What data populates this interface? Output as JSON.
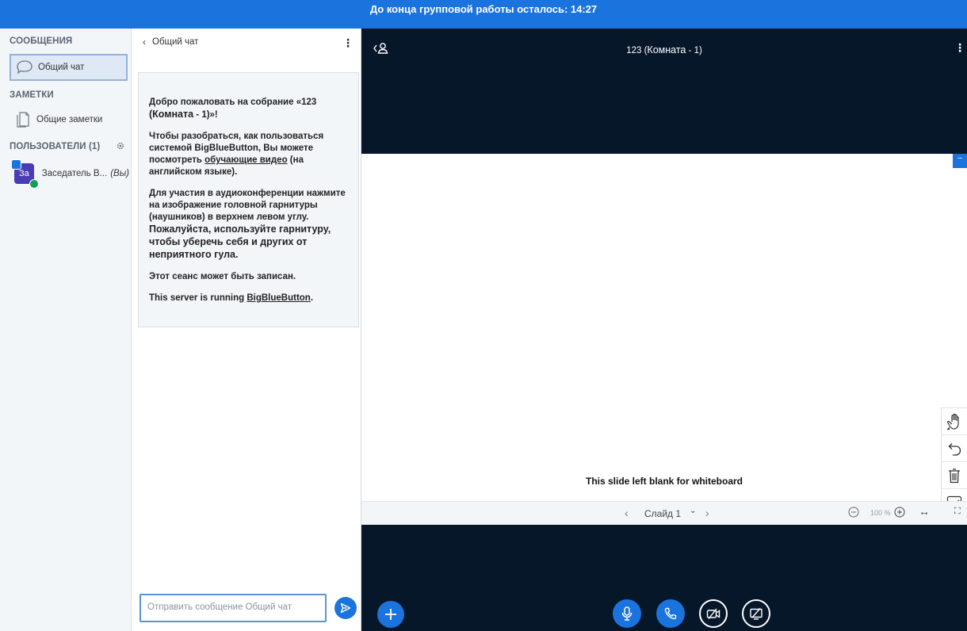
{
  "topbar": {
    "timer_text": "До конца групповой работы осталось: 14:27"
  },
  "sidebar": {
    "messages_heading": "СООБЩЕНИЯ",
    "public_chat_label": "Общий чат",
    "notes_heading": "ЗАМЕТКИ",
    "shared_notes_label": "Общие заметки",
    "users_heading": "ПОЛЬЗОВАТЕЛИ (1)",
    "user": {
      "avatar_initials": "За",
      "name": "Заседатель В...",
      "you_label": "(Вы)"
    }
  },
  "chat": {
    "header_title": "Общий чат",
    "welcome": {
      "line1": "Добро пожаловать на собрание «123",
      "line2_bold": "(Комната",
      "line2_rest": " - 1)»!",
      "p2_a": "Чтобы разобраться, как пользоваться системой BigBlueButton, Вы можете посмотреть ",
      "p2_link": "обучающие видео",
      "p2_b": " (на английском языке).",
      "p3_a": "Для участия в аудиоконференции нажмите на изображение головной гарнитуры (наушников) в верхнем левом углу. ",
      "p3_big": "Пожалуйста, используйте гарнитуру, чтобы уберечь себя и других от неприятного гула.",
      "p4": "Этот сеанс может быть записан.",
      "p5_a": "This server is running ",
      "p5_link": "BigBlueButton",
      "p5_b": "."
    },
    "input_placeholder": "Отправить сообщение Общий чат"
  },
  "main": {
    "meeting_title_a": "123 (",
    "meeting_title_b": "Комната",
    "meeting_title_c": " - 1)",
    "slide_text": "This slide left blank for whiteboard",
    "slide_label": "Слайд 1",
    "zoom_value": "100 %",
    "blue_tab": "–"
  },
  "colors": {
    "brand": "#1b73de",
    "main_bg": "#06172a",
    "sidebar_bg": "#f3f6f9"
  },
  "icons": [
    "chat-icon",
    "notes-icon",
    "gear-icon",
    "user-toggle-icon",
    "hand-icon",
    "undo-icon",
    "trash-icon",
    "multi-user-icon",
    "plus-icon",
    "mic-icon",
    "phone-icon",
    "camera-off-icon",
    "screenshare-off-icon",
    "send-icon"
  ]
}
